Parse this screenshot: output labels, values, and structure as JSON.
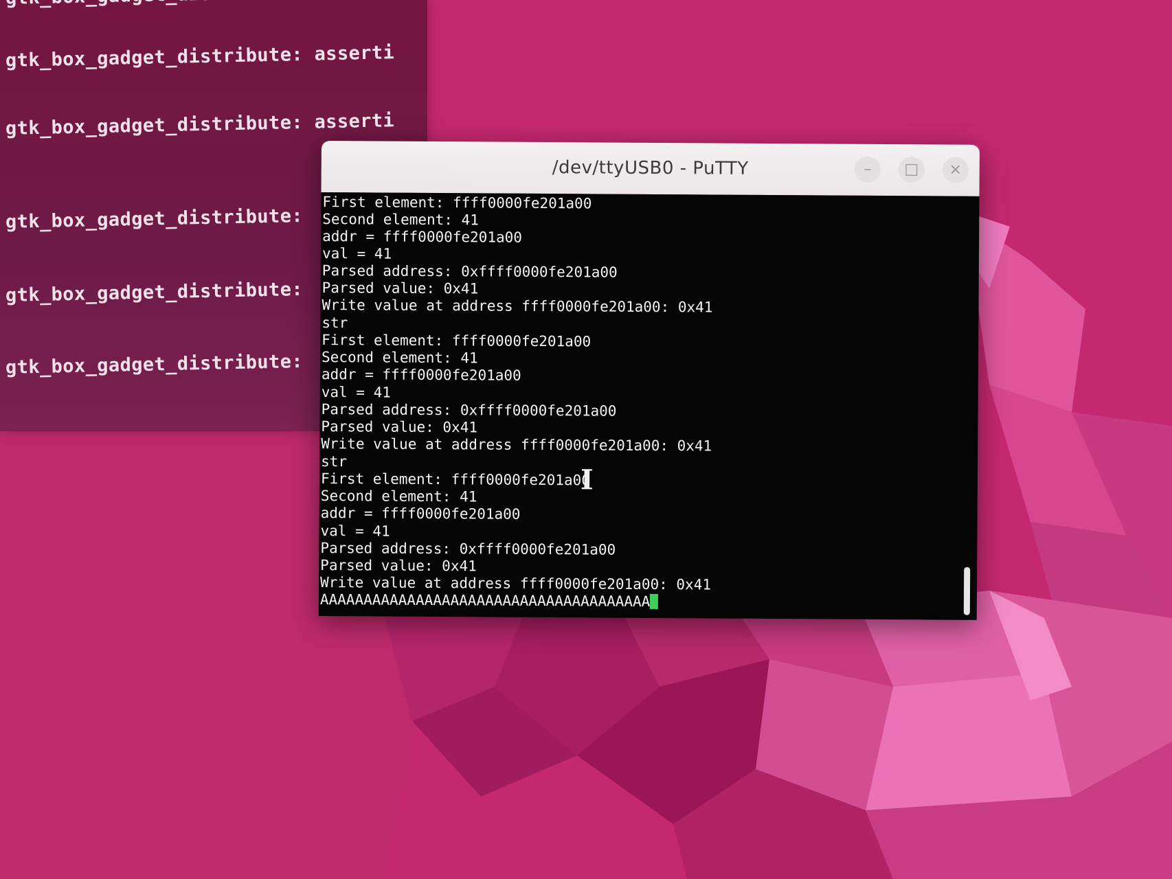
{
  "wallpaper": {
    "base_color": "#c4286f",
    "accent_colors": [
      "#e0559c",
      "#f07ac0",
      "#9a1656",
      "#a71e61"
    ]
  },
  "background_terminal": {
    "lines": [
      "gtk_box_gadget_distribute: asserti",
      "gtk_box_gadget_distribute: asserti",
      "gtk_box_gadget_distribute:",
      "gtk_box_gadget_distribute:",
      "gtk_box_gadget_distribute:"
    ]
  },
  "putty": {
    "title": "/dev/ttyUSB0 - PuTTY",
    "buttons": {
      "minimize": "–",
      "maximize": "□",
      "close": "×"
    },
    "lines": [
      "First element: ffff0000fe201a00",
      "Second element: 41",
      "addr = ffff0000fe201a00",
      "val = 41",
      "Parsed address: 0xffff0000fe201a00",
      "Parsed value: 0x41",
      "Write value at address ffff0000fe201a00: 0x41",
      "str",
      "First element: ffff0000fe201a00",
      "Second element: 41",
      "addr = ffff0000fe201a00",
      "val = 41",
      "Parsed address: 0xffff0000fe201a00",
      "Parsed value: 0x41",
      "Write value at address ffff0000fe201a00: 0x41",
      "str",
      "First element: ffff0000fe201a00",
      "Second element: 41",
      "addr = ffff0000fe201a00",
      "val = 41",
      "Parsed address: 0xffff0000fe201a00",
      "Parsed value: 0x41",
      "Write value at address ffff0000fe201a00: 0x41"
    ],
    "input_line": "AAAAAAAAAAAAAAAAAAAAAAAAAAAAAAAAAAAAAA",
    "cursor_color": "#3ecf5a",
    "mouse_cursor": "ibeam-icon"
  }
}
